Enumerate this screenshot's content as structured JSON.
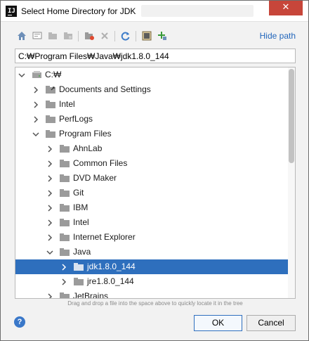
{
  "window": {
    "title": "Select Home Directory for JDK",
    "app_icon_text": "IJ",
    "close_glyph": "✕"
  },
  "toolbar": {
    "buttons": [
      "home-icon",
      "desktop-icon",
      "project-icon",
      "module-icon",
      "new-folder-icon",
      "delete-icon",
      "refresh-icon",
      "show-hidden-icon",
      "add-library-icon"
    ],
    "hide_path_label": "Hide path"
  },
  "path": {
    "value": "C:₩Program Files₩Java₩jdk1.8.0_144"
  },
  "tree": {
    "rows": [
      {
        "label": "C:₩",
        "expanded": true,
        "type": "drive"
      },
      {
        "label": "Documents and Settings",
        "expanded": false,
        "type": "link"
      },
      {
        "label": "Intel",
        "expanded": false,
        "type": "folder"
      },
      {
        "label": "PerfLogs",
        "expanded": false,
        "type": "folder"
      },
      {
        "label": "Program Files",
        "expanded": true,
        "type": "folder"
      },
      {
        "label": "AhnLab",
        "expanded": false,
        "type": "folder"
      },
      {
        "label": "Common Files",
        "expanded": false,
        "type": "folder"
      },
      {
        "label": "DVD Maker",
        "expanded": false,
        "type": "folder"
      },
      {
        "label": "Git",
        "expanded": false,
        "type": "folder"
      },
      {
        "label": "IBM",
        "expanded": false,
        "type": "folder"
      },
      {
        "label": "Intel",
        "expanded": false,
        "type": "folder"
      },
      {
        "label": "Internet Explorer",
        "expanded": false,
        "type": "folder"
      },
      {
        "label": "Java",
        "expanded": true,
        "type": "folder"
      },
      {
        "label": "jdk1.8.0_144",
        "expanded": false,
        "type": "folder",
        "selected": true
      },
      {
        "label": "jre1.8.0_144",
        "expanded": false,
        "type": "folder"
      },
      {
        "label": "JetBrains",
        "expanded": false,
        "type": "folder"
      }
    ]
  },
  "hint": "Drag and drop a file into the space above to quickly locate it in the tree",
  "buttons": {
    "ok": "OK",
    "cancel": "Cancel",
    "help": "?"
  },
  "colors": {
    "selection": "#2e6fbd",
    "link": "#2266bb",
    "close": "#c7463a"
  }
}
